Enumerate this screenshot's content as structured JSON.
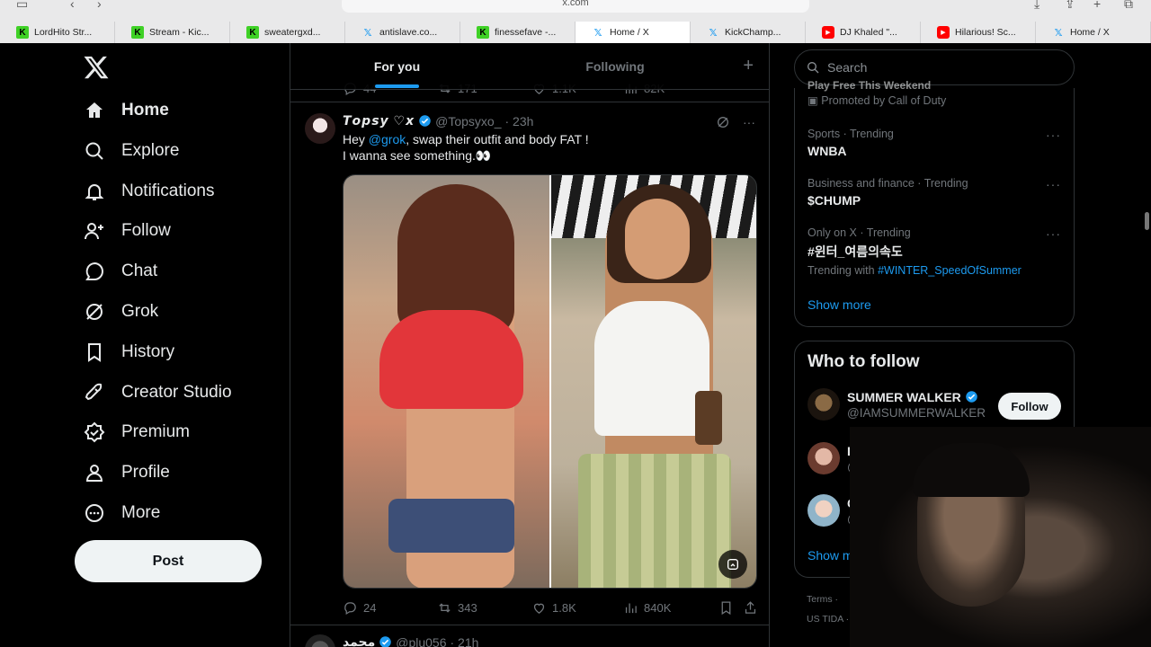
{
  "browser": {
    "url": "x.com",
    "tabs": [
      {
        "label": "LordHito Str...",
        "favicon": "kick-icon",
        "active": false
      },
      {
        "label": "Stream - Kic...",
        "favicon": "kick-icon",
        "active": false
      },
      {
        "label": "sweatergxd...",
        "favicon": "kick-icon",
        "active": false
      },
      {
        "label": "antislave.co...",
        "favicon": "x-icon",
        "active": false
      },
      {
        "label": "finessefave -...",
        "favicon": "kick-icon",
        "active": false
      },
      {
        "label": "Home / X",
        "favicon": "x-icon",
        "active": true
      },
      {
        "label": "KickChamp...",
        "favicon": "x-icon",
        "active": false
      },
      {
        "label": "DJ Khaled \"...",
        "favicon": "youtube-icon",
        "active": false
      },
      {
        "label": "Hilarious! Sc...",
        "favicon": "youtube-icon",
        "active": false
      },
      {
        "label": "Home / X",
        "favicon": "x-icon",
        "active": false
      }
    ]
  },
  "nav": {
    "items": [
      {
        "label": "Home",
        "icon": "home-icon"
      },
      {
        "label": "Explore",
        "icon": "search-icon"
      },
      {
        "label": "Notifications",
        "icon": "bell-icon"
      },
      {
        "label": "Follow",
        "icon": "person-add-icon"
      },
      {
        "label": "Chat",
        "icon": "chat-icon"
      },
      {
        "label": "Grok",
        "icon": "grok-icon"
      },
      {
        "label": "History",
        "icon": "bookmark-icon"
      },
      {
        "label": "Creator Studio",
        "icon": "rocket-icon"
      },
      {
        "label": "Premium",
        "icon": "premium-icon"
      },
      {
        "label": "Profile",
        "icon": "person-icon"
      },
      {
        "label": "More",
        "icon": "more-circle-icon"
      }
    ],
    "post_label": "Post"
  },
  "timeline": {
    "tabs": {
      "for_you": "For you",
      "following": "Following"
    },
    "prev_stats": {
      "replies": "44",
      "reposts": "171",
      "likes": "1.1K",
      "views": "82K"
    },
    "tweet": {
      "name": "𝙏𝙤𝙥𝙨𝙮 ♡𝙭",
      "handle": "@Topsyxo_",
      "time": "· 23h",
      "text_before": "Hey ",
      "mention": "@grok",
      "text_after": ", swap their outfit and body FAT !",
      "line2": "I wanna see something.👀",
      "stats": {
        "replies": "24",
        "reposts": "343",
        "likes": "1.8K",
        "views": "840K"
      }
    },
    "next_tweet": {
      "name": "محمد",
      "handle": "@plu056",
      "time": "· 21h"
    }
  },
  "search": {
    "placeholder": "Search"
  },
  "trends": {
    "promo_top": "Play Free This Weekend",
    "promo_label": "Promoted by Call of Duty",
    "items": [
      {
        "meta": "Sports · Trending",
        "name": "WNBA"
      },
      {
        "meta": "Business and finance · Trending",
        "name": "$CHUMP"
      },
      {
        "meta": "Only on X · Trending",
        "name": "#윈터_여름의속도",
        "with_label": "Trending with",
        "with_tag": "#WINTER_SpeedOfSummer"
      }
    ],
    "show_more": "Show more"
  },
  "who_to_follow": {
    "title": "Who to follow",
    "users": [
      {
        "name": "SUMMER WALKER",
        "handle": "@IAMSUMMERWALKER",
        "verified": true
      },
      {
        "name": "I",
        "handle": "@",
        "verified": false
      },
      {
        "name": "C",
        "handle": "@",
        "verified": false
      }
    ],
    "follow_label": "Follow",
    "show_more": "Show m"
  },
  "footer": {
    "terms": "Terms",
    "region": "US TIDA"
  },
  "colors": {
    "accent": "#1d9bf0",
    "background": "#000000",
    "border": "#2f3336",
    "muted": "#71767b"
  }
}
